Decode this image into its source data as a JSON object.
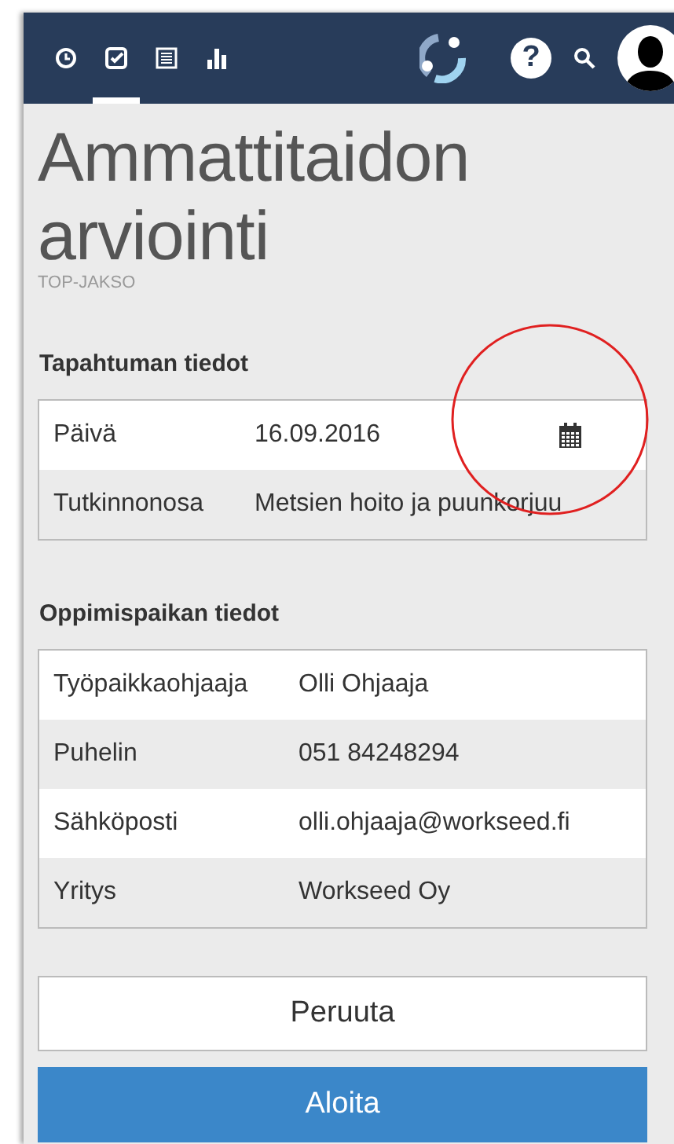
{
  "header": {
    "tabs": [
      {
        "kind": "clock",
        "selected": false
      },
      {
        "kind": "check",
        "selected": true
      },
      {
        "kind": "list",
        "selected": false
      },
      {
        "kind": "chart",
        "selected": false
      }
    ],
    "help": "?"
  },
  "page": {
    "title": "Ammattitaidon arviointi",
    "subtitle": "TOP-JAKSO"
  },
  "sections": [
    {
      "heading": "Tapahtuman tiedot",
      "rows": [
        {
          "kind": "date",
          "label": "Päivä",
          "value": "16.09.2016"
        },
        {
          "kind": "text",
          "label": "Tutkinnonosa",
          "value": "Metsien hoito ja puunkorjuu"
        }
      ]
    },
    {
      "heading": "Oppimispaikan tiedot",
      "rows": [
        {
          "kind": "text",
          "label": "Työpaikkaohjaaja",
          "value": "Olli Ohjaaja"
        },
        {
          "kind": "text",
          "label": "Puhelin",
          "value": "051 84248294"
        },
        {
          "kind": "text",
          "label": "Sähköposti",
          "value": "olli.ohjaaja@workseed.fi"
        },
        {
          "kind": "text",
          "label": "Yritys",
          "value": "Workseed Oy"
        }
      ]
    }
  ],
  "buttons": [
    {
      "kind": "secondary",
      "label": "Peruuta"
    },
    {
      "kind": "primary",
      "label": "Aloita"
    }
  ],
  "annotation": {
    "kind": "circle"
  }
}
